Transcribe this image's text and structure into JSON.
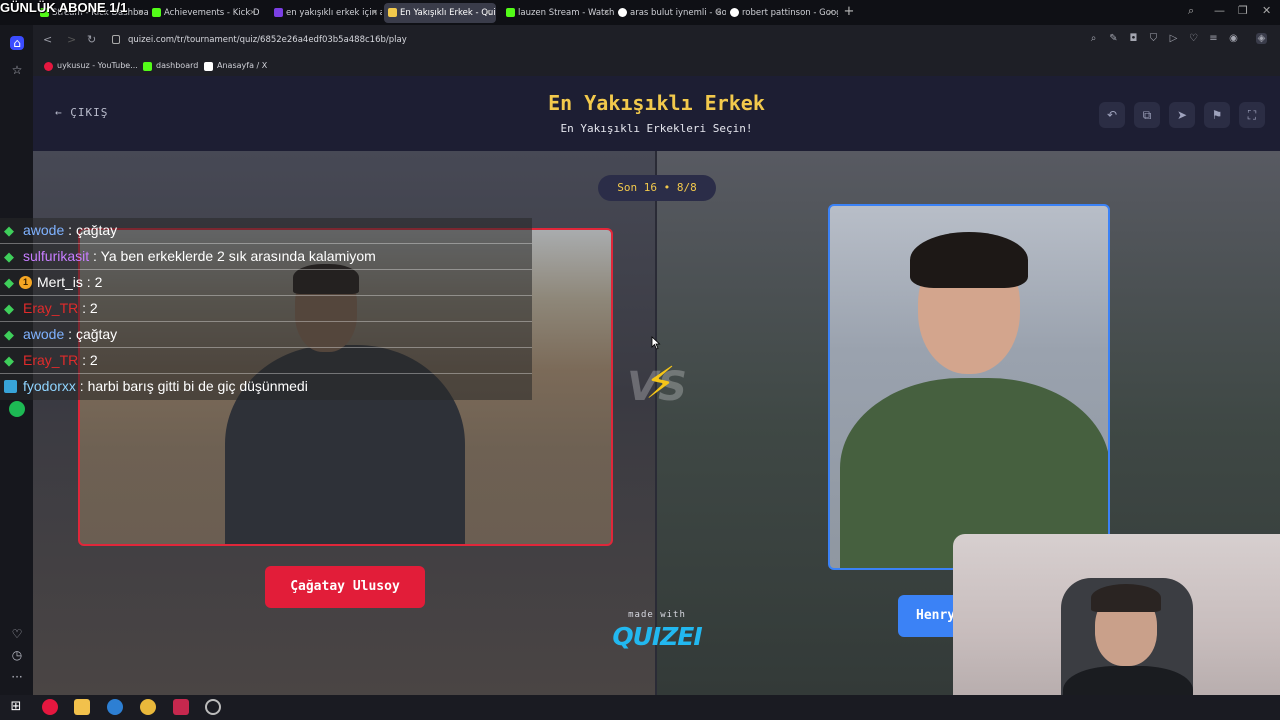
{
  "stream_overlay": {
    "title": "GÜNLÜK ABONE 1/1"
  },
  "tabs": [
    {
      "label": "Stream - Kick Dashboard",
      "color": "#53fc18"
    },
    {
      "label": "Achievements - Kick Dash",
      "color": "#53fc18"
    },
    {
      "label": "en yakışıklı erkek için aranı",
      "color": "#7b3fe4"
    },
    {
      "label": "En Yakışıklı Erkek - Quizei",
      "color": "#f2c94c"
    },
    {
      "label": "lauzen Stream - Watch Liv",
      "color": "#53fc18"
    },
    {
      "label": "aras bulut iynemli - Goog",
      "color": "#ffffff"
    },
    {
      "label": "robert pattinson - Google",
      "color": "#ffffff"
    }
  ],
  "address_bar": {
    "url": "quizei.com/tr/tournament/quiz/6852e26a4edf03b5a488c16b/play"
  },
  "bookmarks": [
    {
      "label": "uykusuz - YouTube...",
      "color": "#e5173f"
    },
    {
      "label": "dashboard",
      "color": "#53fc18"
    },
    {
      "label": "Anasayfa / X",
      "color": "#ffffff"
    }
  ],
  "quiz": {
    "exit_label": "ÇIKIŞ",
    "title": "En Yakışıklı Erkek",
    "subtitle": "En Yakışıklı Erkekleri Seçin!",
    "round_badge": "Son 16 • 8/8",
    "vs_label": "VS",
    "left_choice": {
      "name": "Çağatay Ulusoy"
    },
    "right_choice": {
      "name": "Henry Cavill"
    },
    "made_with": "made with",
    "brand": "QUIZEI"
  },
  "chat": [
    {
      "user": "awode",
      "user_color": "#7fb2ff",
      "badge": "diamond",
      "message": "çağtay"
    },
    {
      "user": "sulfurikasit",
      "user_color": "#c77dff",
      "badge": "diamond",
      "message": "Ya ben erkeklerde 2 sık arasında kalamiyom"
    },
    {
      "user": "Mert_is",
      "user_color": "#ffffff",
      "badge": "coin",
      "message": "2"
    },
    {
      "user": "Eray_TR",
      "user_color": "#e02b2b",
      "badge": "diamond",
      "message": "2"
    },
    {
      "user": "awode",
      "user_color": "#7fb2ff",
      "badge": "diamond",
      "message": "çağtay"
    },
    {
      "user": "Eray_TR",
      "user_color": "#e02b2b",
      "badge": "diamond",
      "message": "2"
    },
    {
      "user": "fyodorxx",
      "user_color": "#8fd4ff",
      "badge": "sub",
      "message": "harbi barış gitti bi de giç düşünmedi"
    }
  ],
  "colors": {
    "accent_yellow": "#f2c94c",
    "left_red": "#e21d39",
    "right_blue": "#3b82f6",
    "brand_cyan": "#22b8f0"
  }
}
